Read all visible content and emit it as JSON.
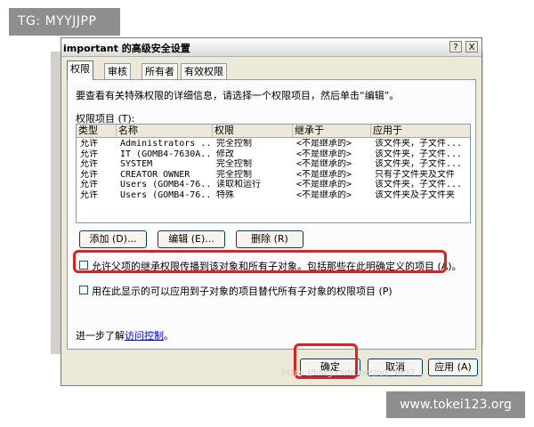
{
  "watermarks": {
    "top_left": "TG: MYYJJPP",
    "bottom_right": "www.tokei123.org",
    "url_overlay": "https://blog.csdn.net/qq_3402..."
  },
  "dialog": {
    "title": "important 的高级安全设置",
    "help_btn": "?",
    "close_btn": "X",
    "tabs": [
      "权限",
      "审核",
      "所有者",
      "有效权限"
    ],
    "active_tab": 0,
    "description": "要查看有关特殊权限的详细信息，请选择一个权限项目，然后单击“编辑”。",
    "entries_label": "权限项目 (T):",
    "columns": [
      "类型",
      "名称",
      "权限",
      "继承于",
      "应用于"
    ],
    "rows": [
      [
        "允许",
        "Administrators ...",
        "完全控制",
        "<不是继承的>",
        "该文件夹，子文件..."
      ],
      [
        "允许",
        "IT (GOMB4-7630A...",
        "修改",
        "<不是继承的>",
        "该文件夹，子文件..."
      ],
      [
        "允许",
        "SYSTEM",
        "完全控制",
        "<不是继承的>",
        "该文件夹，子文件..."
      ],
      [
        "允许",
        "CREATOR OWNER",
        "完全控制",
        "<不是继承的>",
        "只有子文件夹及文件"
      ],
      [
        "允许",
        "Users (GOMB4-76...",
        "读取和运行",
        "<不是继承的>",
        "该文件夹，子文件..."
      ],
      [
        "允许",
        "Users (GOMB4-76...",
        "特殊",
        "<不是继承的>",
        "该文件夹及子文件夹"
      ]
    ],
    "buttons": {
      "add": "添加 (D)...",
      "edit": "编辑 (E)...",
      "remove": "删除 (R)"
    },
    "inherit_checkbox": "允许父项的继承权限传播到该对象和所有子对象。包括那些在此明确定义的项目 (A)。",
    "replace_checkbox": "用在此显示的可以应用到子对象的项目替代所有子对象的权限项目 (P)",
    "learn_more_prefix": "进一步了解",
    "learn_more_link": "访问控制",
    "learn_more_suffix": "。",
    "ok": "确定",
    "cancel": "取消",
    "apply": "应用 (A)"
  },
  "colors": {
    "highlight": "#e02020",
    "dialog_bg": "#ece9d8"
  }
}
